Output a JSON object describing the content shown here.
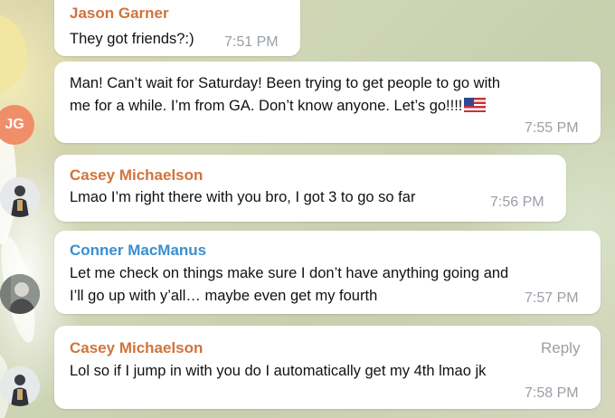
{
  "messages": [
    {
      "sender": "Jason Garner",
      "text": "They got friends?:)",
      "time": "7:51 PM"
    },
    {
      "lines": [
        "Man!  Can’t wait for Saturday!   Been trying to get people to go with",
        "me for a while.  I’m from GA.   Don’t know anyone.   Let’s go!!!!"
      ],
      "emoji": "us-flag",
      "time": "7:55 PM",
      "avatar_initials": "JG"
    },
    {
      "sender": "Casey Michaelson",
      "text": "Lmao I’m right there with you bro, I got 3 to go so far",
      "time": "7:56 PM"
    },
    {
      "sender": "Conner MacManus",
      "lines": [
        "Let me check on things make sure I don’t have anything going and",
        "I’ll go up with y’all… maybe even get my fourth"
      ],
      "time": "7:57 PM"
    },
    {
      "sender": "Casey Michaelson",
      "reply_label": "Reply",
      "text": "Lol so if I jump in with you do I automatically get my 4th lmao jk",
      "time": "7:58 PM"
    }
  ],
  "colors": {
    "orange_name": "#d0743c",
    "blue_name": "#3a8fd0",
    "avatar_jg": "#f08e6a"
  }
}
